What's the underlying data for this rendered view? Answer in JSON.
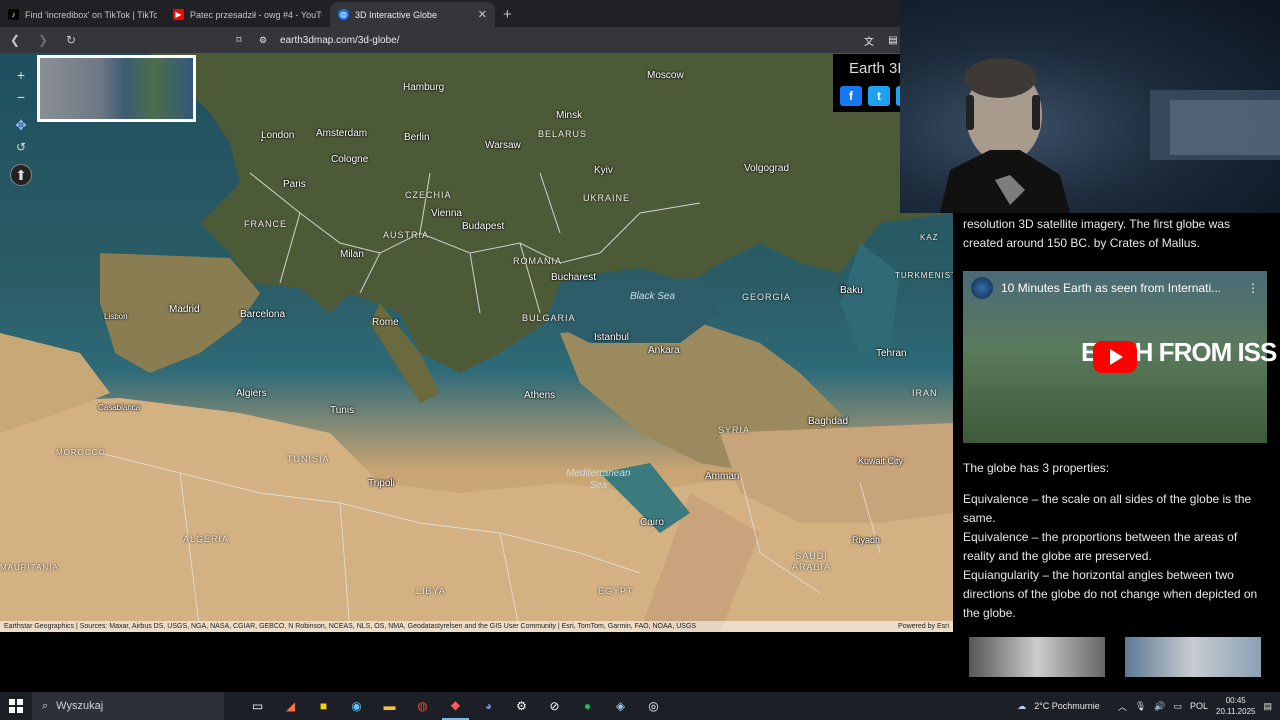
{
  "browser": {
    "tabs": [
      {
        "title": "Find 'incredibox' on TikTok | TikTok Se",
        "icon": "tiktok-icon",
        "active": false
      },
      {
        "title": "Patec przesadził - owg #4 - YouTube",
        "icon": "youtube-icon",
        "active": false
      },
      {
        "title": "3D Interactive Globe",
        "icon": "globe-icon",
        "active": true
      }
    ],
    "url": "earth3dmap.com/3d-globe/"
  },
  "map": {
    "banner_title": "Earth 3D",
    "labels": {
      "london": "London",
      "amsterdam": "Amsterdam",
      "berlin": "Berlin",
      "hamburg": "Hamburg",
      "cologne": "Cologne",
      "paris": "Paris",
      "france": "FRANCE",
      "warsaw": "Warsaw",
      "belarus": "BELARUS",
      "minsk": "Minsk",
      "moscow": "Moscow",
      "kyiv": "Kyiv",
      "ukraine": "UKRAINE",
      "volgograd": "Volgograd",
      "czechia": "CZECHIA",
      "vienna": "Vienna",
      "austria": "AUSTRIA",
      "budapest": "Budapest",
      "milan": "Milan",
      "romania": "ROMANIA",
      "bucharest": "Bucharest",
      "madrid": "Madrid",
      "barcelona": "Barcelona",
      "lisbon": "Lisbon",
      "rome": "Rome",
      "bulgaria": "BULGARIA",
      "istanbul": "Istanbul",
      "black_sea": "Black Sea",
      "georgia": "GEORGIA",
      "baku": "Baku",
      "ankara": "Ankara",
      "tehran": "Tehran",
      "iran": "IRAN",
      "algiers": "Algiers",
      "casablanca": "Casablanca",
      "tunis": "Tunis",
      "tunisia": "TUNISIA",
      "athens": "Athens",
      "syria": "SYRIA",
      "baghdad": "Baghdad",
      "morocco": "MOROCCO",
      "tripoli": "Tripoli",
      "med_sea": "Mediterranean\nSea",
      "amman": "Amman",
      "kuwait": "Kuwait City",
      "algeria": "ALGERIA",
      "cairo": "Cairo",
      "saudi": "SAUDI\nARABIA",
      "riyadh": "Riyadh",
      "libya": "LIBYA",
      "egypt": "EGYPT",
      "mauritania": "MAURITANIA",
      "turkmenistan": "TURKMENISTAN",
      "kazakhstan": "KAZ"
    },
    "attribution": "Earthstar Geographics | Sources: Maxar, Airbus DS, USGS, NGA, NASA, CGIAR, GEBCO, N Robinson, NCEAS, NLS, OS, NMA, Geodatastyrelsen and the GIS User Community | Esri, TomTom, Garmin, FAO, NOAA, USGS",
    "powered": "Powered by Esri"
  },
  "article": {
    "intro": "resolution 3D satellite imagery.  The first globe was created around 150 BC. by Crates of Mallus.",
    "video_title": "10 Minutes Earth as seen from Internati...",
    "video_overlay": "E      H FROM ISS",
    "properties_heading": "The globe has 3 properties:",
    "properties": [
      "Equivalence – the scale on all sides of the globe is the same.",
      "Equivalence – the proportions between the areas of reality and the globe are preserved.",
      "Equiangularity – the horizontal angles between two directions of the globe do not change when depicted on the globe."
    ]
  },
  "taskbar": {
    "search_placeholder": "Wyszukaj",
    "weather": "2°C  Pochmurnie",
    "language": "POL",
    "time": "00:45",
    "date": "20.11.2025"
  }
}
